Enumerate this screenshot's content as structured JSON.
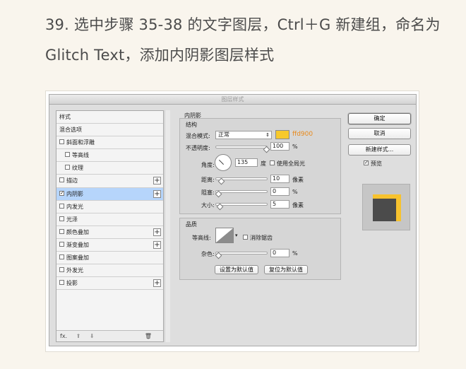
{
  "step_text": "39. 选中步骤 35-38 的文字图层，Ctrl＋G 新建组，命名为 Glitch Text，添加内阴影图层样式",
  "dialog": {
    "title": "图层样式",
    "styles_list": [
      {
        "label": "样式",
        "checkbox": false,
        "plus": false,
        "checked": false
      },
      {
        "label": "混合选项",
        "checkbox": false,
        "plus": false,
        "checked": false
      },
      {
        "label": "斜面和浮雕",
        "checkbox": true,
        "plus": false,
        "checked": false
      },
      {
        "label": "等高线",
        "checkbox": true,
        "plus": false,
        "checked": false,
        "sub": true
      },
      {
        "label": "纹理",
        "checkbox": true,
        "plus": false,
        "checked": false,
        "sub": true
      },
      {
        "label": "描边",
        "checkbox": true,
        "plus": true,
        "checked": false
      },
      {
        "label": "内阴影",
        "checkbox": true,
        "plus": true,
        "checked": true,
        "selected": true
      },
      {
        "label": "内发光",
        "checkbox": true,
        "plus": false,
        "checked": false
      },
      {
        "label": "光泽",
        "checkbox": true,
        "plus": false,
        "checked": false
      },
      {
        "label": "颜色叠加",
        "checkbox": true,
        "plus": true,
        "checked": false
      },
      {
        "label": "渐变叠加",
        "checkbox": true,
        "plus": true,
        "checked": false
      },
      {
        "label": "图案叠加",
        "checkbox": true,
        "plus": false,
        "checked": false
      },
      {
        "label": "外发光",
        "checkbox": true,
        "plus": false,
        "checked": false
      },
      {
        "label": "投影",
        "checkbox": true,
        "plus": true,
        "checked": false
      }
    ],
    "footer": {
      "fx": "fx.",
      "up": "⬆",
      "down": "⬇",
      "trash": "🗑"
    },
    "inner_shadow": {
      "section": "内阴影",
      "structure": "结构",
      "blend_mode_label": "混合模式:",
      "blend_mode_value": "正常",
      "color_hex": "ffd900",
      "color_swatch": "#f7c92c",
      "opacity_label": "不透明度:",
      "opacity_value": "100",
      "percent": "%",
      "angle_label": "角度:",
      "angle_value": "135",
      "degree": "度",
      "global_light": "使用全局光",
      "distance_label": "距离:",
      "distance_value": "10",
      "px": "像素",
      "choke_label": "阻塞:",
      "choke_value": "0",
      "size_label": "大小:",
      "size_value": "5",
      "quality": "品质",
      "contour_label": "等高线:",
      "anti_alias": "消除锯齿",
      "noise_label": "杂色:",
      "noise_value": "0",
      "set_default": "设置为默认值",
      "reset_default": "复位为默认值"
    },
    "buttons": {
      "ok": "确定",
      "cancel": "取消",
      "new_style": "新建样式...",
      "preview": "预览"
    }
  }
}
